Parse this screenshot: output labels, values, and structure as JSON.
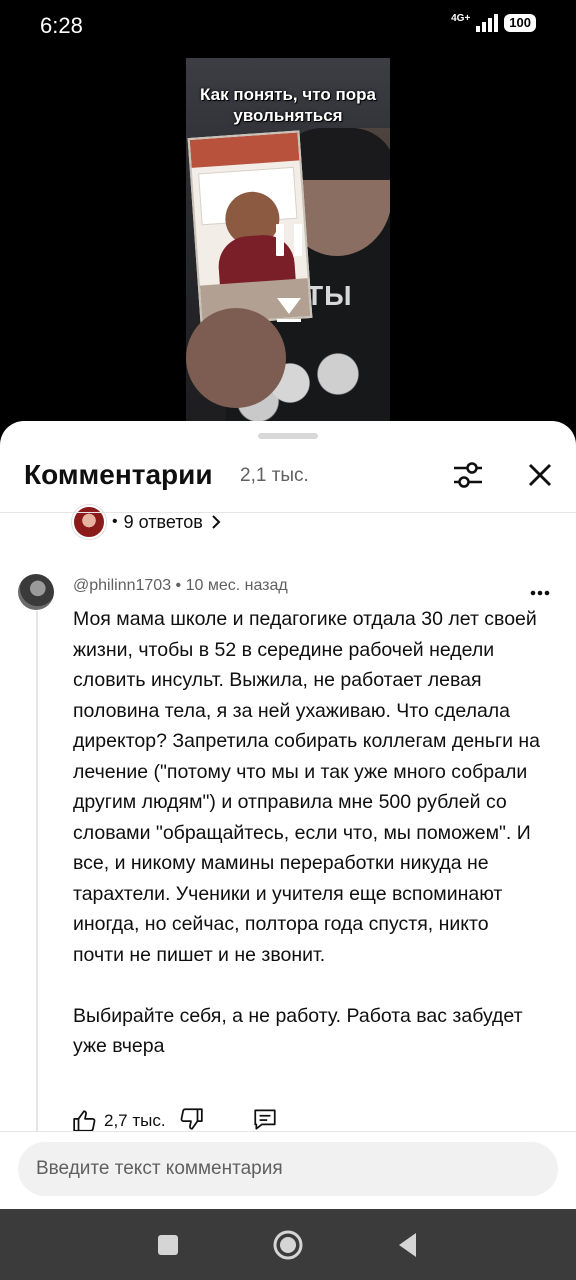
{
  "status_bar": {
    "time": "6:28",
    "network": "4G+",
    "battery": "100"
  },
  "video": {
    "title_overlay": "Как понять, что пора увольняться",
    "shirt_text": "ТЫ"
  },
  "comments_panel": {
    "title": "Комментарии",
    "count": "2,1 тыс.",
    "replies_link": "9 ответов",
    "comment": {
      "meta": "@philinn1703 • 10 мес. назад",
      "text": "Моя мама школе и педагогике отдала 30 лет своей жизни, чтобы в 52 в середине рабочей недели словить инсульт. Выжила, не работает левая половина тела, я за ней ухаживаю. Что сделала директор? Запретила собирать коллегам деньги на лечение (\"потому что мы и так уже много собрали другим людям\") и отправила мне 500 рублей со словами \"обращайтесь, если что, мы поможем\". И все, и никому мамины переработки никуда не тарахтели. Ученики и учителя еще вспоминают иногда, но сейчас, полтора года спустя, никто почти не пишет и не звонит.\n\nВыбирайте себя, а не работу. Работа вас забудет уже вчера",
      "likes": "2,7 тыс."
    },
    "input_placeholder": "Введите текст комментария"
  },
  "icons": [
    "filter-icon",
    "close-icon",
    "more-icon",
    "thumb-up-icon",
    "thumb-down-icon",
    "reply-icon",
    "pause-icon",
    "chevron-down-icon",
    "nav-recents-icon",
    "nav-home-icon",
    "nav-back-icon"
  ],
  "colors": {
    "sheet_background": "#ffffff",
    "primary_text": "#0f0f0f",
    "secondary_text": "#606060",
    "input_background": "#f1f1f1",
    "nav_bar": "#3b3b3b"
  }
}
